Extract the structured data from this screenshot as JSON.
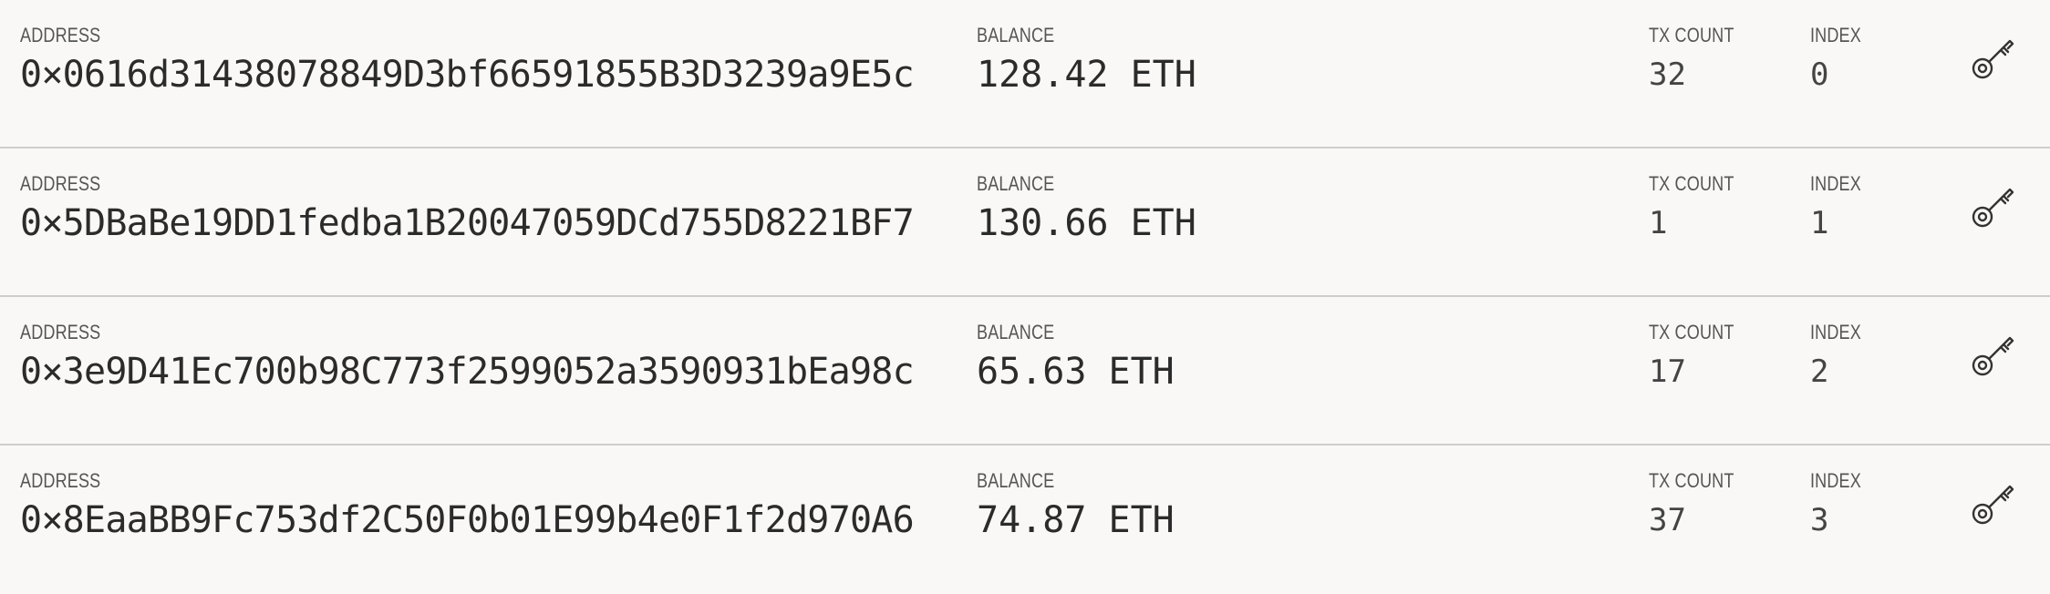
{
  "labels": {
    "address": "ADDRESS",
    "balance": "BALANCE",
    "tx_count": "TX COUNT",
    "index": "INDEX"
  },
  "accounts": [
    {
      "address": "0×0616d31438078849D3bf66591855B3D3239a9E5c",
      "balance": "128.42 ETH",
      "tx_count": "32",
      "index": "0",
      "action_icon": "key-icon"
    },
    {
      "address": "0×5DBaBe19DD1fedba1B20047059DCd755D8221BF7",
      "balance": "130.66 ETH",
      "tx_count": "1",
      "index": "1",
      "action_icon": "key-icon"
    },
    {
      "address": "0×3e9D41Ec700b98C773f2599052a3590931bEa98c",
      "balance": "65.63 ETH",
      "tx_count": "17",
      "index": "2",
      "action_icon": "key-icon"
    },
    {
      "address": "0×8EaaBB9Fc753df2C50F0b01E99b4e0F1f2d970A6",
      "balance": "74.87 ETH",
      "tx_count": "37",
      "index": "3",
      "action_icon": "key-icon"
    }
  ],
  "colors": {
    "background": "#f9f8f6",
    "divider": "#cfcdca",
    "label": "#555555",
    "value": "#2b2b2b"
  }
}
